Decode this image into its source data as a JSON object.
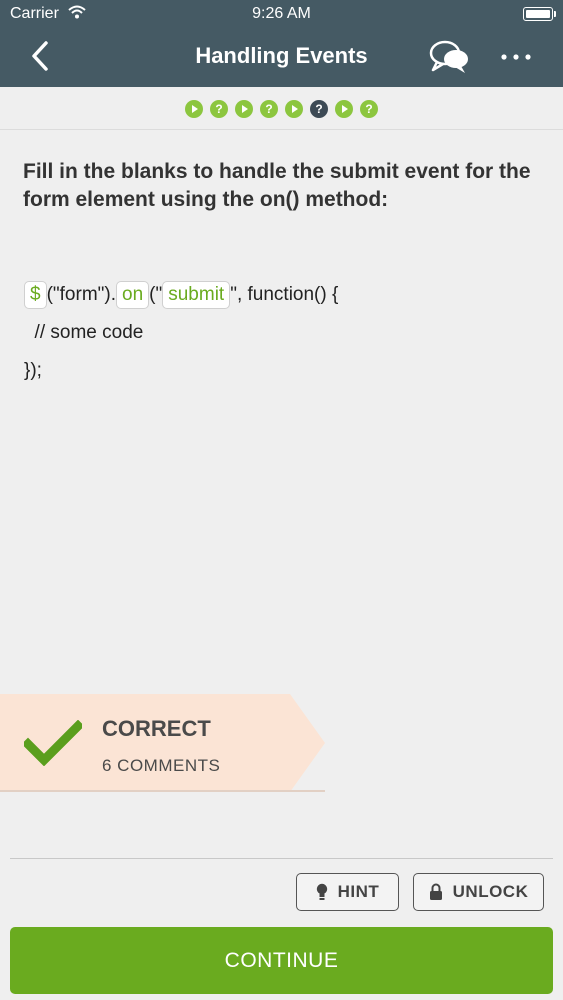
{
  "status_bar": {
    "carrier": "Carrier",
    "time": "9:26 AM"
  },
  "nav": {
    "title": "Handling Events"
  },
  "progress": {
    "steps": [
      {
        "kind": "lesson"
      },
      {
        "kind": "quiz"
      },
      {
        "kind": "lesson"
      },
      {
        "kind": "quiz"
      },
      {
        "kind": "lesson"
      },
      {
        "kind": "quiz",
        "current": true
      },
      {
        "kind": "lesson"
      },
      {
        "kind": "quiz"
      }
    ],
    "quiz_glyph": "?",
    "accent": "#8cc63f",
    "current_color": "#3d4a55"
  },
  "question": {
    "text": "Fill in the blanks to handle the submit event for the form element using the on() method:"
  },
  "code": {
    "blank1": "$",
    "part1": "(\"form\").",
    "blank2": "on",
    "part2": "(\"",
    "blank3": "submit",
    "part3": "\", function() {",
    "line2": "  // some code",
    "line3": "});"
  },
  "result": {
    "status": "CORRECT",
    "comments": "6 COMMENTS",
    "check_color": "#5a9e1d"
  },
  "actions": {
    "hint": "HINT",
    "unlock": "UNLOCK",
    "continue": "CONTINUE",
    "brand": "#6aab1f"
  },
  "icons": {
    "back": "chevron-left-icon",
    "comments": "speech-bubbles-icon",
    "more": "more-horizontal-icon",
    "hint": "lightbulb-icon",
    "unlock": "lock-icon",
    "check": "checkmark-icon",
    "wifi": "wifi-icon",
    "battery": "battery-icon"
  }
}
